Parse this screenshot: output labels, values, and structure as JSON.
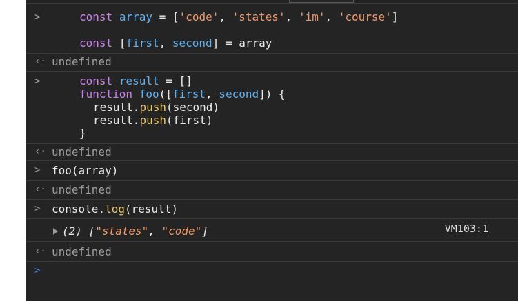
{
  "console": {
    "source_link": "VM103:1",
    "entries": [
      {
        "type": "input",
        "prompt": ">",
        "lines": [
          [
            "const",
            "array",
            "=",
            "['code',",
            "'states',",
            "'im',",
            "'course']"
          ],
          [
            "const",
            "[first,",
            "second]",
            "=",
            "array"
          ]
        ]
      },
      {
        "type": "result",
        "prompt": "<",
        "text": "undefined"
      },
      {
        "type": "input",
        "prompt": ">",
        "code": [
          "const result = []",
          "function foo([first, second]) {",
          "  result.push(second)",
          "  result.push(first)",
          "}"
        ]
      },
      {
        "type": "result",
        "prompt": "<",
        "text": "undefined"
      },
      {
        "type": "input",
        "prompt": ">",
        "text": "foo(array)"
      },
      {
        "type": "result",
        "prompt": "<",
        "text": "undefined"
      },
      {
        "type": "input",
        "prompt": ">",
        "text": "console.log(result)"
      },
      {
        "type": "log",
        "text": "(2) [\"states\", \"code\"]"
      },
      {
        "type": "result",
        "prompt": "<",
        "text": "undefined"
      },
      {
        "type": "prompt",
        "prompt": ">"
      }
    ]
  },
  "tokens": {
    "const": "const",
    "function": "function",
    "array": "array",
    "first": "first",
    "second": "second",
    "result": "result",
    "foo": "foo",
    "push": "push",
    "console": "console",
    "log": "log",
    "eq": "=",
    "s_code": "'code'",
    "s_states": "'states'",
    "s_im": "'im'",
    "s_course": "'course'",
    "undefined": "undefined",
    "log_count": "(2)",
    "log_states": "\"states\"",
    "log_code": "\"code\""
  },
  "colors": {
    "background": "#242424",
    "keyword": "#cc7ff0",
    "identifier": "#5db0f2",
    "string": "#f29766",
    "method": "#e8c766",
    "prompt_active": "#4b8cf5"
  }
}
